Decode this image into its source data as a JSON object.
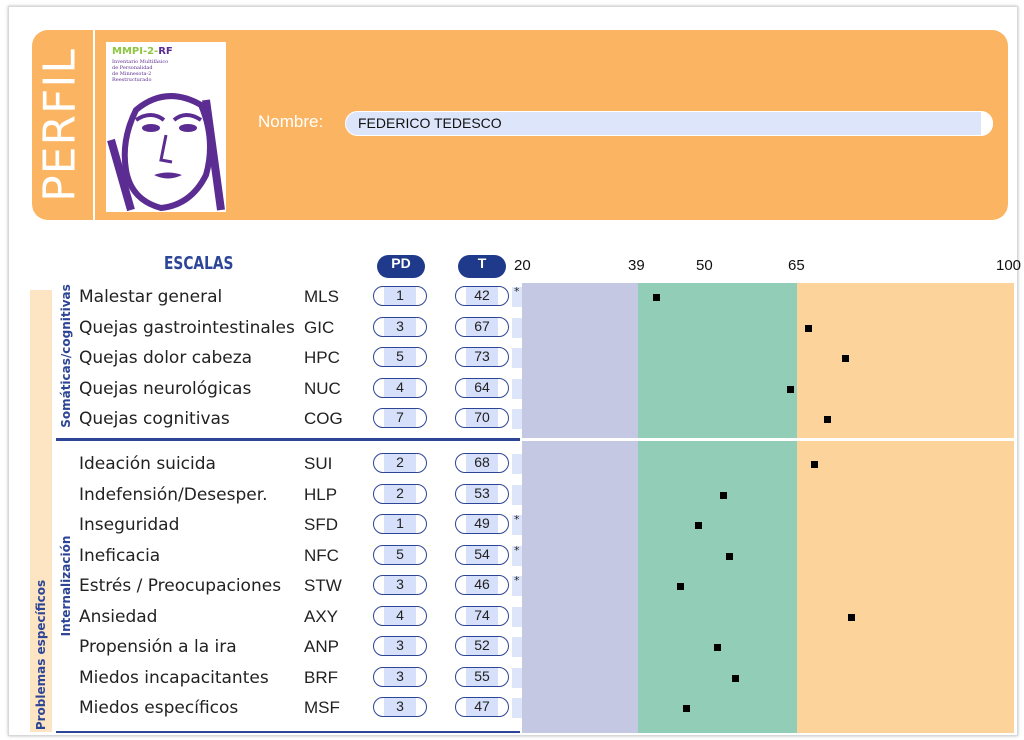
{
  "header": {
    "title": "PERFIL",
    "cover": {
      "brand": "MMPI-2-RF",
      "subtitle": "Inventario Multifásico de Personalidad de Minnesota-2 Reestructurado"
    },
    "nombre_label": "Nombre:",
    "nombre_value": "FEDERICO TEDESCO"
  },
  "table": {
    "escalas_label": "ESCALAS",
    "pd_label": "PD",
    "t_label": "T",
    "groups": [
      {
        "label": "Somáticas/cognitivas",
        "rows": [
          {
            "name": "Malestar general",
            "abbr": "MLS",
            "pd": "1",
            "t": "42",
            "flag": "*"
          },
          {
            "name": "Quejas gastrointestinales",
            "abbr": "GIC",
            "pd": "3",
            "t": "67",
            "flag": ""
          },
          {
            "name": "Quejas dolor cabeza",
            "abbr": "HPC",
            "pd": "5",
            "t": "73",
            "flag": ""
          },
          {
            "name": "Quejas neurológicas",
            "abbr": "NUC",
            "pd": "4",
            "t": "64",
            "flag": ""
          },
          {
            "name": "Quejas cognitivas",
            "abbr": "COG",
            "pd": "7",
            "t": "70",
            "flag": ""
          }
        ]
      },
      {
        "label": "Internalización",
        "rows": [
          {
            "name": "Ideación suicida",
            "abbr": "SUI",
            "pd": "2",
            "t": "68",
            "flag": ""
          },
          {
            "name": "Indefensión/Desesper.",
            "abbr": "HLP",
            "pd": "2",
            "t": "53",
            "flag": ""
          },
          {
            "name": "Inseguridad",
            "abbr": "SFD",
            "pd": "1",
            "t": "49",
            "flag": "*"
          },
          {
            "name": "Ineficacia",
            "abbr": "NFC",
            "pd": "5",
            "t": "54",
            "flag": "*"
          },
          {
            "name": "Estrés / Preocupaciones",
            "abbr": "STW",
            "pd": "3",
            "t": "46",
            "flag": "*"
          },
          {
            "name": "Ansiedad",
            "abbr": "AXY",
            "pd": "4",
            "t": "74",
            "flag": ""
          },
          {
            "name": "Propensión a la ira",
            "abbr": "ANP",
            "pd": "3",
            "t": "52",
            "flag": ""
          },
          {
            "name": "Miedos incapacitantes",
            "abbr": "BRF",
            "pd": "3",
            "t": "55",
            "flag": ""
          },
          {
            "name": "Miedos específicos",
            "abbr": "MSF",
            "pd": "3",
            "t": "47",
            "flag": ""
          }
        ]
      }
    ],
    "outer_group_label": "Problemas específicos"
  },
  "chart_data": {
    "type": "scatter",
    "x_ticks": [
      "20",
      "39",
      "50",
      "65",
      "100"
    ],
    "xlim": [
      20,
      100
    ],
    "bands": [
      {
        "from": 20,
        "to": 39,
        "color": "#c5c8e2"
      },
      {
        "from": 39,
        "to": 65,
        "color": "#92cdb8"
      },
      {
        "from": 65,
        "to": 100,
        "color": "#fcd39b"
      }
    ],
    "categories": [
      "MLS",
      "GIC",
      "HPC",
      "NUC",
      "COG",
      "SUI",
      "HLP",
      "SFD",
      "NFC",
      "STW",
      "AXY",
      "ANP",
      "BRF",
      "MSF"
    ],
    "values": [
      42,
      67,
      73,
      64,
      70,
      68,
      53,
      49,
      54,
      46,
      74,
      52,
      55,
      47
    ]
  },
  "colors": {
    "header": "#fbb562",
    "accent": "#1f3a8a",
    "field": "#dde5fb"
  }
}
